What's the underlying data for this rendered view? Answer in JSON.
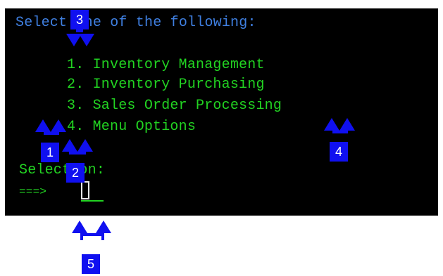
{
  "terminal": {
    "prompt_header": "Select one of the following:",
    "menu_items": [
      "1. Inventory Management",
      "2. Inventory Purchasing",
      "3. Sales Order Processing",
      "4. Menu Options"
    ],
    "selection_label": "Selection:",
    "input_prompt": "===>",
    "colors": {
      "background": "#000000",
      "header": "#3f7fe0",
      "menu": "#22d422"
    }
  },
  "callouts": {
    "marker_1": "1",
    "marker_2": "2",
    "marker_3": "3",
    "marker_4": "4",
    "marker_5": "5",
    "color": "#1010f0"
  }
}
